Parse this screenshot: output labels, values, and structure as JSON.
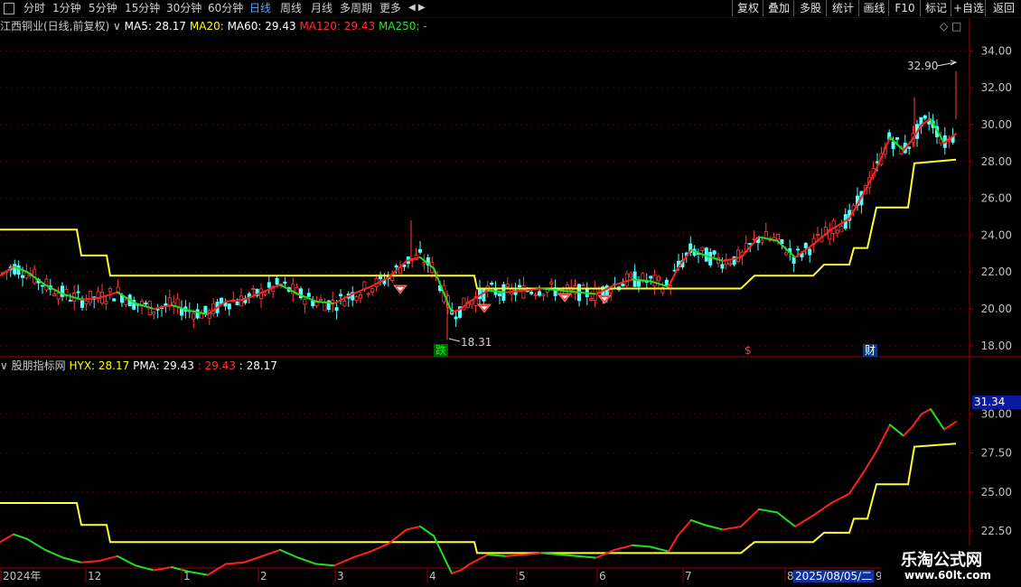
{
  "toolbar": {
    "left_items": [
      "分时",
      "1分钟",
      "5分钟",
      "15分钟",
      "30分钟",
      "60分钟",
      "日线",
      "周线",
      "月线",
      "多周期",
      "更多"
    ],
    "active": "日线",
    "right_items": [
      "复权",
      "叠加",
      "多股",
      "统计",
      "画线",
      "F10",
      "标记",
      "+自选",
      "返回"
    ]
  },
  "main": {
    "title": "江西铜业(日线,前复权)",
    "ma_labels": [
      {
        "text": "MA5: 28.17",
        "color": "#ffffff"
      },
      {
        "text": "MA20: ",
        "color": "#ffff00"
      },
      {
        "text": "MA60: 29.43",
        "color": "#ffffff"
      },
      {
        "text": "MA120: 29.43",
        "color": "#ff3030"
      },
      {
        "text": "MA250: -",
        "color": "#30e030"
      }
    ],
    "high_label": "32.90",
    "low_label": "18.31",
    "markers": [
      {
        "text": "跌",
        "color": "#00ff00",
        "bg": "#006000"
      },
      {
        "text": "$",
        "color": "#ff3030",
        "bg": ""
      },
      {
        "text": "财",
        "color": "#ffffff",
        "bg": "#003c8c"
      }
    ],
    "yaxis": [
      "34.00",
      "32.00",
      "30.00",
      "28.00",
      "26.00",
      "24.00",
      "22.00",
      "20.00",
      "18.00"
    ]
  },
  "sub": {
    "title": "股朋指标网",
    "values": [
      {
        "text": "HYX: 28.17",
        "color": "#ffff00"
      },
      {
        "text": "PMA: 29.43",
        "color": "#ffffff"
      },
      {
        "text": ": 29.43",
        "color": "#ff3030"
      },
      {
        "text": ": 28.17",
        "color": "#ffffff"
      }
    ],
    "yaxis": [
      "30.00",
      "27.50",
      "25.00",
      "22.50"
    ],
    "current": "31.34"
  },
  "xaxis": {
    "labels": [
      "2024年",
      "12",
      "1",
      "2",
      "3",
      "4",
      "5",
      "6",
      "7",
      "8",
      "9"
    ],
    "date_box": "2025/08/05/二"
  },
  "watermark": {
    "line1": "乐淘公式网",
    "line2": "www.60lt.com"
  },
  "chart_data": {
    "type": "candlestick",
    "title": "江西铜业(日线,前复权)",
    "ylim": [
      17.5,
      35
    ],
    "line_pts": [
      [
        0,
        21.8
      ],
      [
        15,
        22.3
      ],
      [
        30,
        22.0
      ],
      [
        50,
        21.3
      ],
      [
        70,
        20.8
      ],
      [
        90,
        20.5
      ],
      [
        110,
        20.6
      ],
      [
        130,
        20.9
      ],
      [
        150,
        20.3
      ],
      [
        170,
        20.0
      ],
      [
        190,
        20.2
      ],
      [
        210,
        19.9
      ],
      [
        230,
        19.7
      ],
      [
        250,
        20.4
      ],
      [
        270,
        20.5
      ],
      [
        290,
        20.9
      ],
      [
        310,
        21.3
      ],
      [
        330,
        20.8
      ],
      [
        350,
        20.4
      ],
      [
        370,
        20.3
      ],
      [
        390,
        20.8
      ],
      [
        410,
        21.2
      ],
      [
        430,
        21.7
      ],
      [
        450,
        22.6
      ],
      [
        465,
        22.8
      ],
      [
        480,
        22.2
      ],
      [
        490,
        21.0
      ],
      [
        500,
        19.8
      ],
      [
        510,
        20.0
      ],
      [
        520,
        20.4
      ],
      [
        540,
        21.0
      ],
      [
        560,
        20.9
      ],
      [
        580,
        21.0
      ],
      [
        600,
        21.1
      ],
      [
        620,
        21.0
      ],
      [
        640,
        20.9
      ],
      [
        660,
        20.8
      ],
      [
        680,
        21.3
      ],
      [
        700,
        21.6
      ],
      [
        720,
        21.5
      ],
      [
        740,
        21.2
      ],
      [
        750,
        22.2
      ],
      [
        765,
        23.2
      ],
      [
        780,
        22.9
      ],
      [
        800,
        22.6
      ],
      [
        820,
        22.8
      ],
      [
        840,
        23.9
      ],
      [
        860,
        23.7
      ],
      [
        880,
        22.8
      ],
      [
        900,
        23.5
      ],
      [
        920,
        24.3
      ],
      [
        940,
        24.9
      ],
      [
        955,
        26.2
      ],
      [
        970,
        27.6
      ],
      [
        985,
        29.3
      ],
      [
        1000,
        28.6
      ],
      [
        1010,
        29.2
      ],
      [
        1020,
        30.0
      ],
      [
        1030,
        30.3
      ],
      [
        1045,
        29.0
      ],
      [
        1058,
        29.5
      ]
    ],
    "hyx_steps": [
      [
        0,
        24.3
      ],
      [
        85,
        24.3
      ],
      [
        90,
        22.9
      ],
      [
        118,
        22.9
      ],
      [
        122,
        21.8
      ],
      [
        525,
        21.8
      ],
      [
        528,
        21.1
      ],
      [
        820,
        21.1
      ],
      [
        835,
        21.8
      ],
      [
        900,
        21.8
      ],
      [
        912,
        22.4
      ],
      [
        940,
        22.4
      ],
      [
        945,
        23.3
      ],
      [
        960,
        23.3
      ],
      [
        970,
        25.5
      ],
      [
        1005,
        25.5
      ],
      [
        1012,
        27.9
      ],
      [
        1058,
        28.1
      ]
    ],
    "sub_ylim": [
      20.2,
      32.5
    ]
  }
}
